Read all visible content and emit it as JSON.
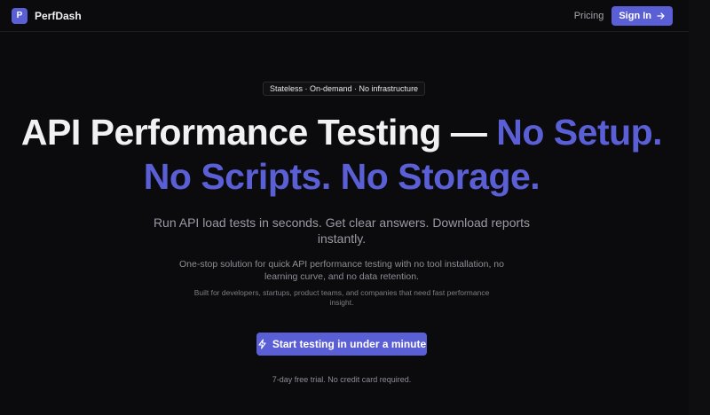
{
  "header": {
    "logo_letter": "P",
    "brand_name": "PerfDash",
    "nav_pricing": "Pricing",
    "signin_label": "Sign In",
    "signin_icon": "arrow-right-icon"
  },
  "hero": {
    "pill_text": "Stateless · On-demand · No infrastructure",
    "headline_part1": "API Performance Testing — ",
    "headline_accent1": "No Setup.",
    "headline_accent2": "No Scripts. No Storage.",
    "subheading": "Run API load tests in seconds. Get clear answers. Download reports instantly.",
    "description": "One-stop solution for quick API performance testing with no tool installation, no learning curve, and no data retention.",
    "audience": "Built for developers, startups, product teams, and companies that need fast performance insight.",
    "cta_label": "Start testing in under a minute",
    "cta_icon": "lightning-icon",
    "trial_note": "7-day free trial. No credit card required."
  },
  "colors": {
    "accent": "#5b5fd6",
    "background": "#0b0b0d"
  }
}
